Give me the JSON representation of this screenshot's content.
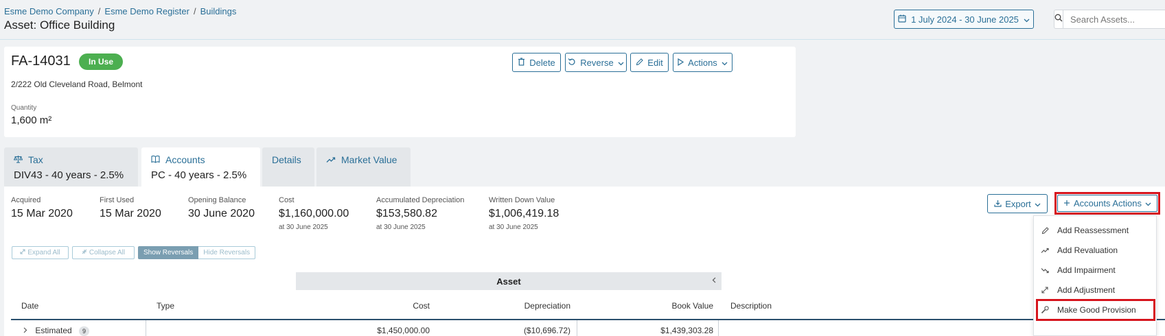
{
  "breadcrumb": {
    "item1": "Esme Demo Company",
    "item2": "Esme Demo Register",
    "item3": "Buildings",
    "separator": "/"
  },
  "page": {
    "title": "Asset: Office Building"
  },
  "date_range": {
    "label": "1 July 2024 - 30 June 2025",
    "icon": "calendar-icon"
  },
  "search": {
    "placeholder": "Search Assets...",
    "icon": "search-icon"
  },
  "asset": {
    "code": "FA-14031",
    "status": "In Use",
    "address": "2/222 Old Cleveland Road, Belmont",
    "quantity_label": "Quantity",
    "quantity_value": "1,600 m²"
  },
  "card_actions": {
    "delete": "Delete",
    "reverse": "Reverse",
    "edit": "Edit",
    "actions": "Actions"
  },
  "tabs": [
    {
      "title": "Tax",
      "sub": "DIV43 - 40 years - 2.5%",
      "icon": "scale-icon"
    },
    {
      "title": "Accounts",
      "sub": "PC - 40 years - 2.5%",
      "icon": "book-icon"
    },
    {
      "title": "Details"
    },
    {
      "title": "Market Value",
      "icon": "trend-up-icon"
    }
  ],
  "stats": [
    {
      "label": "Acquired",
      "value": "15 Mar 2020"
    },
    {
      "label": "First Used",
      "value": "15 Mar 2020"
    },
    {
      "label": "Opening Balance",
      "value": "30 June 2020"
    },
    {
      "label": "Cost",
      "value": "$1,160,000.00",
      "note": "at 30 June 2025"
    },
    {
      "label": "Accumulated Depreciation",
      "value": "$153,580.82",
      "note": "at 30 June 2025"
    },
    {
      "label": "Written Down Value",
      "value": "$1,006,419.18",
      "note": "at 30 June 2025"
    }
  ],
  "panel_actions": {
    "export": "Export",
    "accounts_actions": "Accounts Actions"
  },
  "controls": {
    "expand_all": "Expand All",
    "collapse_all": "Collapse All",
    "show_reversals": "Show Reversals",
    "hide_reversals": "Hide Reversals"
  },
  "table": {
    "group_header": "Asset",
    "columns": [
      "Date",
      "Type",
      "Cost",
      "Depreciation",
      "Book Value",
      "Description"
    ],
    "row": {
      "date": "Estimated",
      "count": "9",
      "cost": "$1,450,000.00",
      "depreciation": "($10,696.72)",
      "book_value": "$1,439,303.28"
    }
  },
  "menu": [
    {
      "label": "Add Reassessment",
      "icon": "pencil-icon"
    },
    {
      "label": "Add Revaluation",
      "icon": "trend-up-icon"
    },
    {
      "label": "Add Impairment",
      "icon": "trend-down-icon"
    },
    {
      "label": "Add Adjustment",
      "icon": "expand-arrows-icon"
    },
    {
      "label": "Make Good Provision",
      "icon": "wrench-icon"
    }
  ],
  "colors": {
    "accent": "#2a6f97",
    "status_green": "#4caf50",
    "highlight_red": "#d6141d"
  }
}
